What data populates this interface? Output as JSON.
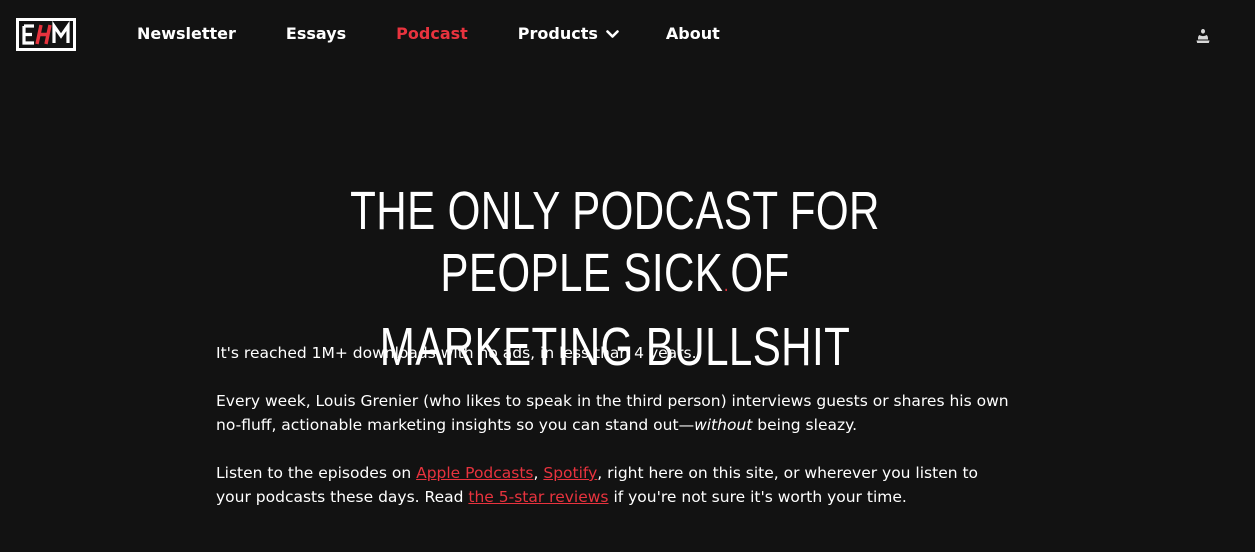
{
  "header": {
    "logo": {
      "letters": "EHM",
      "icon": "ehm-logo"
    },
    "nav": [
      {
        "label": "Newsletter",
        "active": false
      },
      {
        "label": "Essays",
        "active": false
      },
      {
        "label": "Podcast",
        "active": true
      },
      {
        "label": "Products",
        "active": false,
        "has_dropdown": true
      },
      {
        "label": "About",
        "active": false
      }
    ],
    "account_icon": "user-icon"
  },
  "hero": {
    "title_line1_a": "THE ONLY PODCAST FOR PEOPLE SICK",
    "title_dot": ".",
    "title_line1_b": "OF",
    "title_line2": "MARKETING BULLSHIT"
  },
  "body": {
    "p1": "It's reached 1M+ downloads with no ads, in less than 4 years.",
    "p2_a": "Every week, Louis Grenier (who likes to speak in the third person) interviews guests or shares his own no-fluff, actionable marketing insights so you can stand out—",
    "p2_em": "without",
    "p2_b": " being sleazy.",
    "p3_a": "Listen to the episodes on ",
    "p3_link1": "Apple Podcasts",
    "p3_sep": ", ",
    "p3_link2": "Spotify",
    "p3_b": ", right here on this site, or wherever you listen to your podcasts these days. Read ",
    "p3_link3": "the 5-star reviews",
    "p3_c": " if you're not sure it's worth your time."
  },
  "colors": {
    "background": "#121212",
    "accent": "#e8333e",
    "text": "#ffffff"
  }
}
